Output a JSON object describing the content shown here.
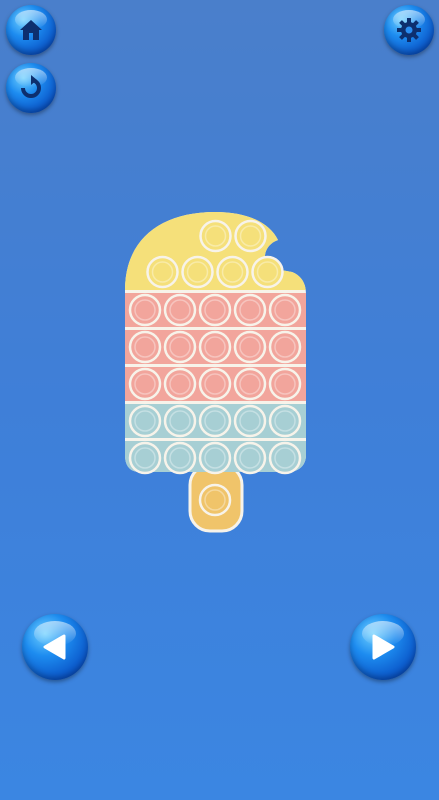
{
  "buttons": {
    "home": {
      "icon": "home-icon"
    },
    "settings": {
      "icon": "gear-icon"
    },
    "restart": {
      "icon": "restart-icon"
    },
    "previous": {
      "icon": "play-left-icon"
    },
    "next": {
      "icon": "play-right-icon"
    }
  },
  "toy": {
    "shape": "popsicle",
    "colors": {
      "yellow": "#f5e07a",
      "pink": "#f2a59c",
      "teal": "#a7cfd4",
      "stick": "#f0c46a",
      "outline": "#f7f3ea"
    },
    "rows": [
      {
        "band": "yellow",
        "bubbles": 2
      },
      {
        "band": "yellow",
        "bubbles": 4
      },
      {
        "band": "pink",
        "bubbles": 5
      },
      {
        "band": "pink",
        "bubbles": 5
      },
      {
        "band": "pink",
        "bubbles": 5
      },
      {
        "band": "teal",
        "bubbles": 5
      },
      {
        "band": "teal",
        "bubbles": 5
      },
      {
        "band": "stick",
        "bubbles": 1
      }
    ]
  }
}
